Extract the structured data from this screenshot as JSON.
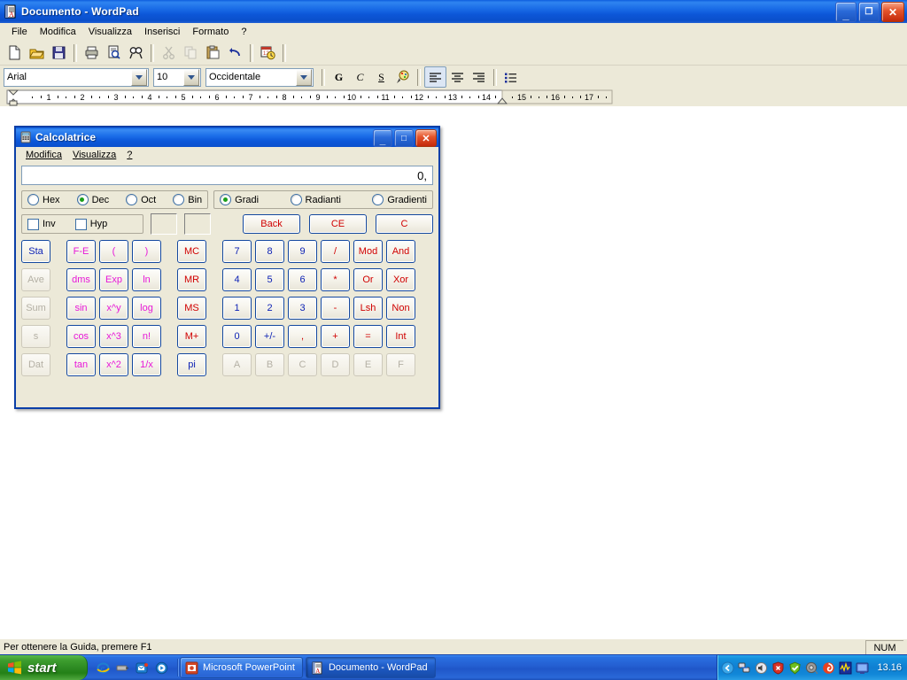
{
  "wordpad": {
    "title": "Documento - WordPad",
    "icon": "wordpad-icon",
    "window_buttons": [
      {
        "name": "minimize-button",
        "glyph": "_"
      },
      {
        "name": "restore-button",
        "glyph": "❐"
      },
      {
        "name": "close-button",
        "glyph": "✕"
      }
    ],
    "menus": [
      "File",
      "Modifica",
      "Visualizza",
      "Inserisci",
      "Formato",
      "?"
    ],
    "toolbar": [
      {
        "name": "new-icon",
        "label": "Nuovo",
        "enabled": true
      },
      {
        "name": "open-icon",
        "label": "Apri",
        "enabled": true
      },
      {
        "name": "save-icon",
        "label": "Salva",
        "enabled": true
      },
      {
        "name": "print-icon",
        "label": "Stampa",
        "enabled": true
      },
      {
        "name": "print-preview-icon",
        "label": "Anteprima di stampa",
        "enabled": true
      },
      {
        "name": "find-icon",
        "label": "Trova",
        "enabled": true
      },
      {
        "name": "cut-icon",
        "label": "Taglia",
        "enabled": false
      },
      {
        "name": "copy-icon",
        "label": "Copia",
        "enabled": false
      },
      {
        "name": "paste-icon",
        "label": "Incolla",
        "enabled": true
      },
      {
        "name": "undo-icon",
        "label": "Annulla",
        "enabled": true
      },
      {
        "name": "date-time-icon",
        "label": "Data e ora",
        "enabled": true
      }
    ],
    "format_bar": {
      "font": "Arial",
      "size": "10",
      "script": "Occidentale",
      "bold_label": "G",
      "italic_label": "C",
      "underline_label": "S",
      "color_icon": "text-color-icon",
      "align_left_icon": "align-left-icon",
      "align_center_icon": "align-center-icon",
      "align_right_icon": "align-right-icon",
      "bullets_icon": "bullets-icon"
    },
    "ruler": {
      "numbers": [
        1,
        2,
        3,
        4,
        5,
        6,
        7,
        8,
        9,
        10,
        11,
        12,
        13,
        14,
        15,
        16,
        17
      ],
      "margin_marker_at": 15
    },
    "status": {
      "help_text": "Per ottenere la Guida, premere F1",
      "num_indicator": "NUM"
    }
  },
  "calculator": {
    "title": "Calcolatrice",
    "icon": "calculator-icon",
    "window_buttons": [
      {
        "name": "minimize-button",
        "glyph": "_"
      },
      {
        "name": "maximize-button",
        "glyph": "□"
      },
      {
        "name": "close-button",
        "glyph": "✕"
      }
    ],
    "menus": [
      "Modifica",
      "Visualizza",
      "?"
    ],
    "display_value": "0,",
    "base_group": [
      {
        "label": "Hex",
        "selected": false
      },
      {
        "label": "Dec",
        "selected": true
      },
      {
        "label": "Oct",
        "selected": false
      },
      {
        "label": "Bin",
        "selected": false
      }
    ],
    "angle_group": [
      {
        "label": "Gradi",
        "selected": true
      },
      {
        "label": "Radianti",
        "selected": false
      },
      {
        "label": "Gradienti",
        "selected": false
      }
    ],
    "checkboxes": [
      {
        "label": "Inv",
        "checked": false
      },
      {
        "label": "Hyp",
        "checked": false
      }
    ],
    "status_boxes": [
      "",
      ""
    ],
    "top_buttons": [
      {
        "label": "Back",
        "color": "#d00000"
      },
      {
        "label": "CE",
        "color": "#d00000"
      },
      {
        "label": "C",
        "color": "#d00000"
      }
    ],
    "columns": [
      {
        "name": "stat-column",
        "keys": [
          {
            "label": "Sta",
            "style": "blue",
            "enabled": true
          },
          {
            "label": "Ave",
            "style": "blue",
            "enabled": false
          },
          {
            "label": "Sum",
            "style": "blue",
            "enabled": false
          },
          {
            "label": "s",
            "style": "blue",
            "enabled": false
          },
          {
            "label": "Dat",
            "style": "blue",
            "enabled": false
          }
        ]
      },
      {
        "name": "function-column-1",
        "keys": [
          {
            "label": "F-E",
            "style": "magenta",
            "enabled": true
          },
          {
            "label": "dms",
            "style": "magenta",
            "enabled": true
          },
          {
            "label": "sin",
            "style": "magenta",
            "enabled": true
          },
          {
            "label": "cos",
            "style": "magenta",
            "enabled": true
          },
          {
            "label": "tan",
            "style": "magenta",
            "enabled": true
          }
        ]
      },
      {
        "name": "function-column-2",
        "keys": [
          {
            "label": "(",
            "style": "magenta",
            "enabled": true
          },
          {
            "label": "Exp",
            "style": "magenta",
            "enabled": true
          },
          {
            "label": "x^y",
            "style": "magenta",
            "enabled": true
          },
          {
            "label": "x^3",
            "style": "magenta",
            "enabled": true
          },
          {
            "label": "x^2",
            "style": "magenta",
            "enabled": true
          }
        ]
      },
      {
        "name": "function-column-3",
        "keys": [
          {
            "label": ")",
            "style": "magenta",
            "enabled": true
          },
          {
            "label": "ln",
            "style": "magenta",
            "enabled": true
          },
          {
            "label": "log",
            "style": "magenta",
            "enabled": true
          },
          {
            "label": "n!",
            "style": "magenta",
            "enabled": true
          },
          {
            "label": "1/x",
            "style": "magenta",
            "enabled": true
          }
        ]
      },
      {
        "name": "memory-column",
        "keys": [
          {
            "label": "MC",
            "style": "red",
            "enabled": true
          },
          {
            "label": "MR",
            "style": "red",
            "enabled": true
          },
          {
            "label": "MS",
            "style": "red",
            "enabled": true
          },
          {
            "label": "M+",
            "style": "red",
            "enabled": true
          },
          {
            "label": "pi",
            "style": "blue",
            "enabled": true
          }
        ]
      },
      {
        "name": "digit-column-1",
        "keys": [
          {
            "label": "7",
            "style": "blue",
            "enabled": true
          },
          {
            "label": "4",
            "style": "blue",
            "enabled": true
          },
          {
            "label": "1",
            "style": "blue",
            "enabled": true
          },
          {
            "label": "0",
            "style": "blue",
            "enabled": true
          },
          {
            "label": "A",
            "style": "blue",
            "enabled": false
          }
        ]
      },
      {
        "name": "digit-column-2",
        "keys": [
          {
            "label": "8",
            "style": "blue",
            "enabled": true
          },
          {
            "label": "5",
            "style": "blue",
            "enabled": true
          },
          {
            "label": "2",
            "style": "blue",
            "enabled": true
          },
          {
            "label": "+/-",
            "style": "blue",
            "enabled": true
          },
          {
            "label": "B",
            "style": "blue",
            "enabled": false
          }
        ]
      },
      {
        "name": "digit-column-3",
        "keys": [
          {
            "label": "9",
            "style": "blue",
            "enabled": true
          },
          {
            "label": "6",
            "style": "blue",
            "enabled": true
          },
          {
            "label": "3",
            "style": "blue",
            "enabled": true
          },
          {
            "label": ",",
            "style": "red",
            "enabled": true
          },
          {
            "label": "C",
            "style": "blue",
            "enabled": false
          }
        ]
      },
      {
        "name": "operator-column",
        "keys": [
          {
            "label": "/",
            "style": "red",
            "enabled": true
          },
          {
            "label": "*",
            "style": "red",
            "enabled": true
          },
          {
            "label": "-",
            "style": "red",
            "enabled": true
          },
          {
            "label": "+",
            "style": "red",
            "enabled": true
          },
          {
            "label": "D",
            "style": "blue",
            "enabled": false
          }
        ]
      },
      {
        "name": "logic-column-1",
        "keys": [
          {
            "label": "Mod",
            "style": "red",
            "enabled": true
          },
          {
            "label": "Or",
            "style": "red",
            "enabled": true
          },
          {
            "label": "Lsh",
            "style": "red",
            "enabled": true
          },
          {
            "label": "=",
            "style": "red",
            "enabled": true
          },
          {
            "label": "E",
            "style": "blue",
            "enabled": false
          }
        ]
      },
      {
        "name": "logic-column-2",
        "keys": [
          {
            "label": "And",
            "style": "red",
            "enabled": true
          },
          {
            "label": "Xor",
            "style": "red",
            "enabled": true
          },
          {
            "label": "Non",
            "style": "red",
            "enabled": true
          },
          {
            "label": "Int",
            "style": "red",
            "enabled": true
          },
          {
            "label": "F",
            "style": "blue",
            "enabled": false
          }
        ]
      }
    ]
  },
  "taskbar": {
    "start_label": "start",
    "quick_launch": [
      {
        "name": "internet-explorer-icon"
      },
      {
        "name": "show-desktop-icon"
      },
      {
        "name": "outlook-express-icon"
      },
      {
        "name": "media-player-icon"
      }
    ],
    "buttons": [
      {
        "name": "taskbar-item-powerpoint",
        "label": "Microsoft PowerPoint",
        "icon": "powerpoint-icon",
        "active": false
      },
      {
        "name": "taskbar-item-wordpad",
        "label": "Documento - WordPad",
        "icon": "wordpad-icon",
        "active": true
      }
    ],
    "tray_icons": [
      {
        "name": "show-hidden-icons-icon"
      },
      {
        "name": "network-connection-icon"
      },
      {
        "name": "volume-icon"
      },
      {
        "name": "security-alert-icon"
      },
      {
        "name": "shield-check-icon"
      },
      {
        "name": "speaker-icon"
      },
      {
        "name": "antivirus-icon"
      },
      {
        "name": "system-monitor-icon"
      },
      {
        "name": "display-icon"
      }
    ],
    "clock": "13.16"
  },
  "colors": {
    "title_blue": "#0c5ce0",
    "window_face": "#ece9d8",
    "digit_blue": "#0a1fb4",
    "function_magenta": "#e718d8",
    "operator_red": "#d00000",
    "radio_green": "#1a9e1a",
    "calc_border": "#0b3fa8"
  }
}
